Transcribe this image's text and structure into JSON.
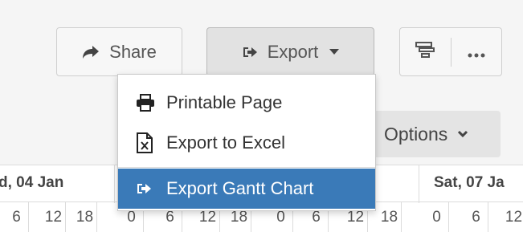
{
  "toolbar": {
    "share_label": "Share",
    "export_label": "Export",
    "options_label": "Options"
  },
  "export_menu": {
    "items": [
      {
        "label": "Printable Page",
        "icon": "print-icon"
      },
      {
        "label": "Export to Excel",
        "icon": "excel-file-icon"
      },
      {
        "label": "Export Gantt Chart",
        "icon": "export-icon",
        "highlighted": true
      }
    ]
  },
  "timeline": {
    "days": [
      "d, 04 Jan",
      "Sat, 07 Ja"
    ],
    "hours": [
      "6",
      "12",
      "18",
      "0",
      "6",
      "12",
      "18",
      "0",
      "6",
      "12",
      "18",
      "0",
      "6",
      "12"
    ]
  },
  "colors": {
    "highlight": "#3a7ab8",
    "toolbar_bg": "#f5f5f5"
  }
}
